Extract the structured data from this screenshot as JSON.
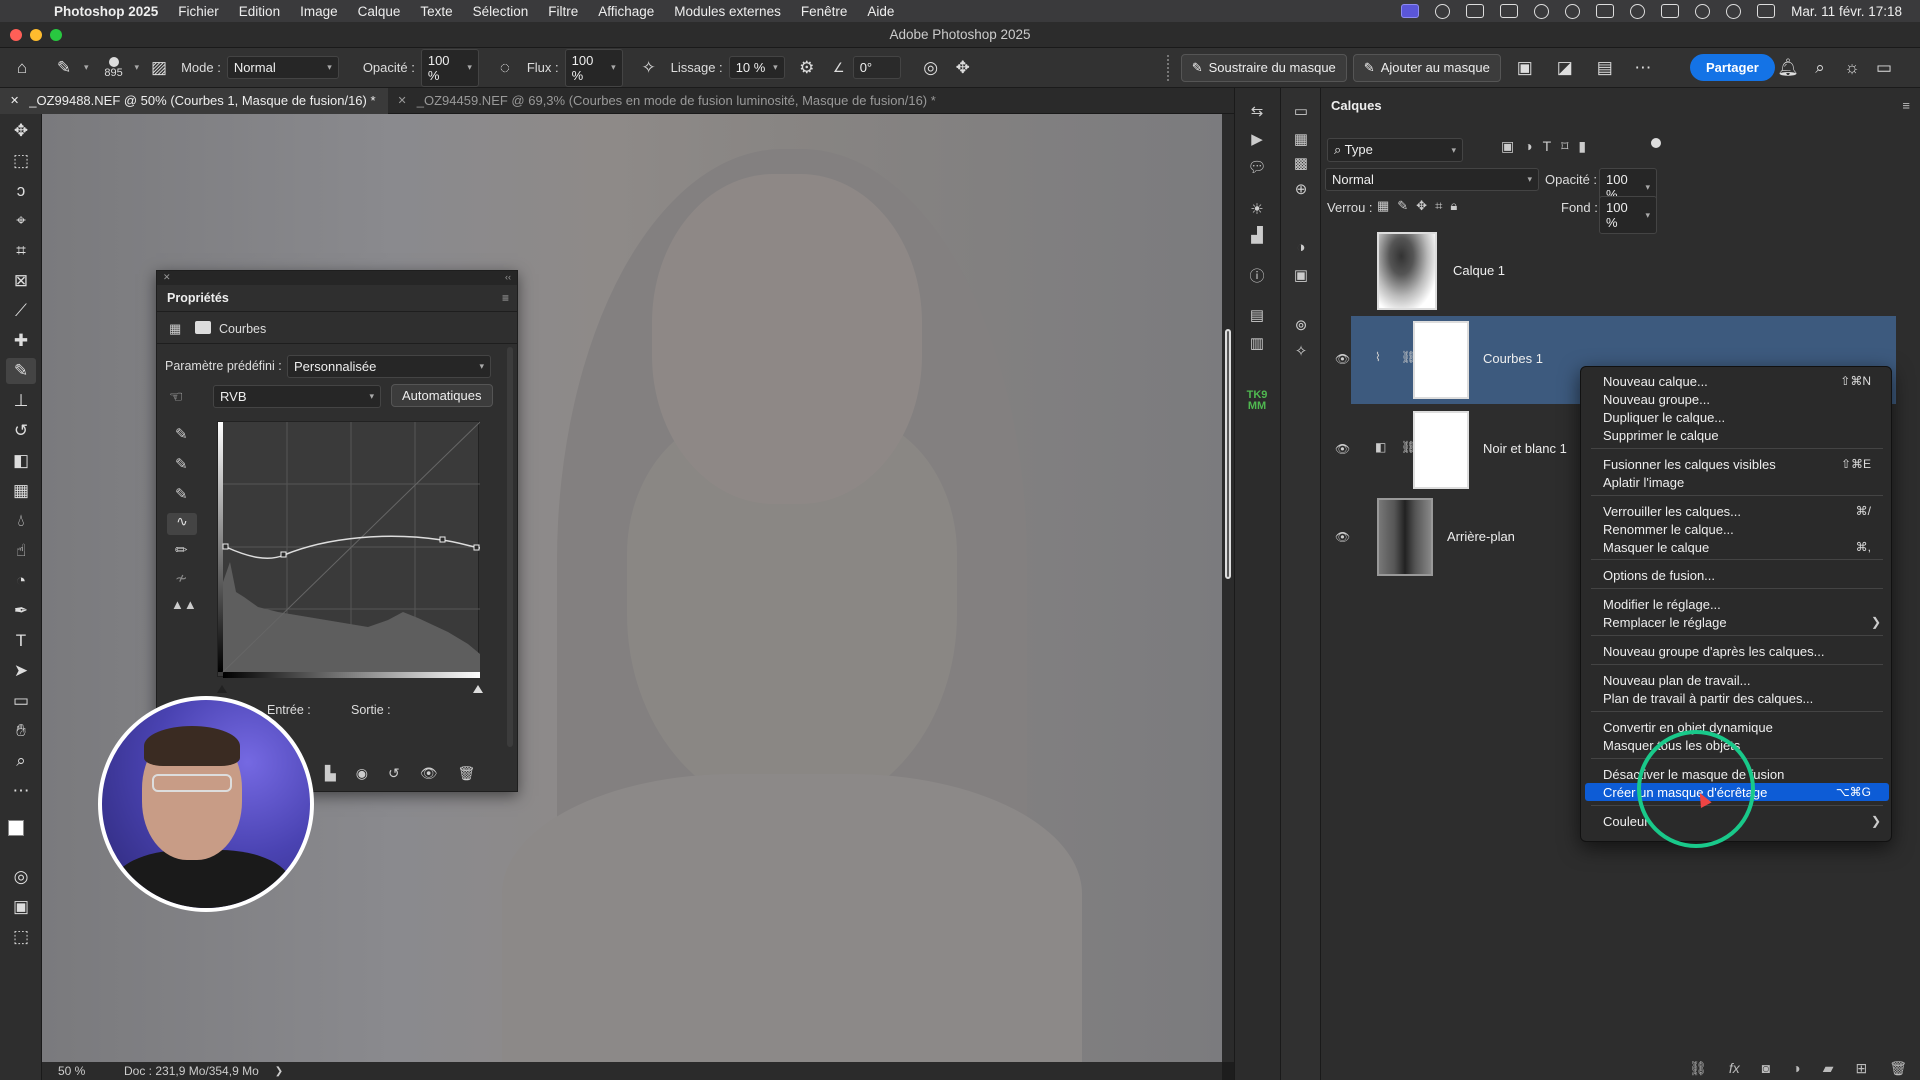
{
  "menubar": {
    "app_name": "Photoshop 2025",
    "items": [
      "Fichier",
      "Edition",
      "Image",
      "Calque",
      "Texte",
      "Sélection",
      "Filtre",
      "Affichage",
      "Modules externes",
      "Fenêtre",
      "Aide"
    ],
    "clock": "Mar. 11 févr. 17:18"
  },
  "window": {
    "title": "Adobe Photoshop 2025"
  },
  "options": {
    "brush_size": "895",
    "mode_label": "Mode :",
    "mode_value": "Normal",
    "opacity_label": "Opacité :",
    "opacity_value": "100 %",
    "flow_label": "Flux :",
    "flow_value": "100 %",
    "smoothing_label": "Lissage :",
    "smoothing_value": "10 %",
    "angle_value": "0°",
    "subtract_mask": "Soustraire du masque",
    "add_mask": "Ajouter au masque",
    "share": "Partager"
  },
  "tabs": [
    {
      "label": "_OZ99488.NEF @ 50% (Courbes 1, Masque de fusion/16) *",
      "active": true
    },
    {
      "label": "_OZ94459.NEF @ 69,3% (Courbes en mode de fusion luminosité, Masque de fusion/16) *",
      "active": false
    }
  ],
  "status": {
    "zoom": "50 %",
    "doc": "Doc : 231,9 Mo/354,9 Mo"
  },
  "properties": {
    "title": "Propriétés",
    "adjustment": "Courbes",
    "preset_label": "Paramètre prédéfini :",
    "preset_value": "Personnalisée",
    "channel": "RVB",
    "auto": "Automatiques",
    "input_label": "Entrée :",
    "output_label": "Sortie :"
  },
  "layers": {
    "title": "Calques",
    "filter": "Type",
    "blend_mode": "Normal",
    "opacity_label": "Opacité :",
    "opacity_value": "100 %",
    "lock_label": "Verrou :",
    "fill_label": "Fond :",
    "fill_value": "100 %",
    "items": [
      {
        "name": "Calque 1",
        "visible": false,
        "selected": false
      },
      {
        "name": "Courbes 1",
        "visible": true,
        "selected": true
      },
      {
        "name": "Noir et blanc 1",
        "visible": true,
        "selected": false
      },
      {
        "name": "Arrière-plan",
        "visible": true,
        "selected": false
      }
    ]
  },
  "context_menu": {
    "items": [
      {
        "label": "Nouveau calque...",
        "shortcut": "⇧⌘N"
      },
      {
        "label": "Nouveau groupe...",
        "shortcut": ""
      },
      {
        "label": "Dupliquer le calque...",
        "shortcut": ""
      },
      {
        "label": "Supprimer le calque",
        "shortcut": ""
      },
      {
        "label": "Fusionner les calques visibles",
        "shortcut": "⇧⌘E"
      },
      {
        "label": "Aplatir l'image",
        "shortcut": ""
      },
      {
        "label": "Verrouiller les calques...",
        "shortcut": "⌘/"
      },
      {
        "label": "Renommer le calque...",
        "shortcut": ""
      },
      {
        "label": "Masquer le calque",
        "shortcut": "⌘,"
      },
      {
        "label": "Options de fusion...",
        "shortcut": ""
      },
      {
        "label": "Modifier le réglage...",
        "shortcut": ""
      },
      {
        "label": "Remplacer le réglage",
        "shortcut": "",
        "submenu": true
      },
      {
        "label": "Nouveau groupe d'après les calques...",
        "shortcut": ""
      },
      {
        "label": "Nouveau plan de travail...",
        "shortcut": ""
      },
      {
        "label": "Plan de travail à partir des calques...",
        "shortcut": ""
      },
      {
        "label": "Convertir en objet dynamique",
        "shortcut": ""
      },
      {
        "label": "Masquer tous les objets",
        "shortcut": ""
      },
      {
        "label": "Désactiver le masque de fusion",
        "shortcut": ""
      },
      {
        "label": "Créer un masque d'écrêtage",
        "shortcut": "⌥⌘G",
        "highlighted": true
      },
      {
        "label": "Couleur",
        "shortcut": "",
        "submenu": true
      }
    ]
  },
  "icons": {
    "toolbar": [
      "move-icon",
      "marquee-icon",
      "lasso-icon",
      "object-select-icon",
      "crop-icon",
      "frame-icon",
      "eyedropper-icon",
      "healing-icon",
      "brush-icon",
      "stamp-icon",
      "history-brush-icon",
      "eraser-icon",
      "gradient-icon",
      "blur-icon",
      "dodge-icon",
      "smudge-icon",
      "pen-icon",
      "type-icon",
      "path-select-icon",
      "rectangle-icon",
      "hand-icon",
      "zoom-icon",
      "more-icon"
    ]
  },
  "colors": {
    "accent": "#1473e6",
    "menu_highlight": "#0d5cd6",
    "annotation": "#19c98a"
  }
}
